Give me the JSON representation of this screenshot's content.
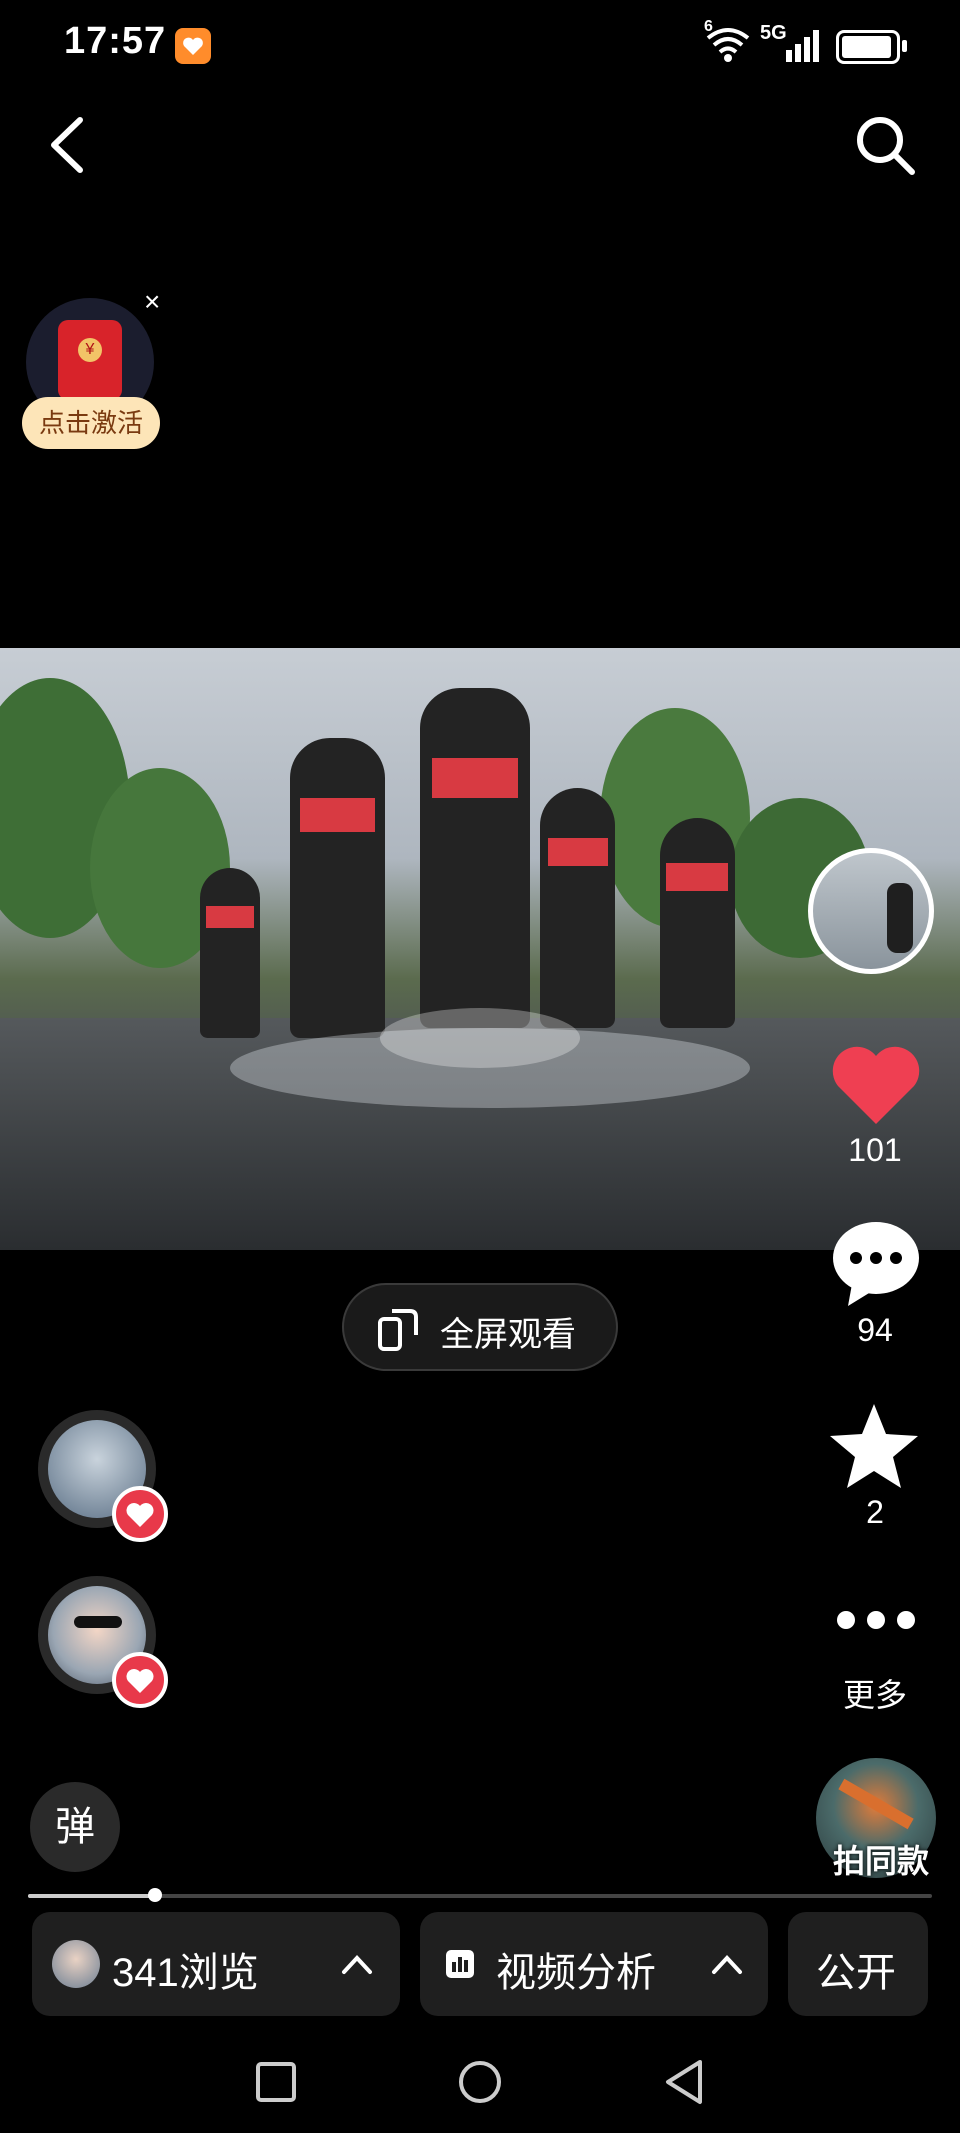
{
  "status_bar": {
    "time": "17:57",
    "network_label": "5G",
    "wifi_superscript": "6",
    "icons": [
      "notification-app-icon",
      "wifi-icon",
      "signal-icon",
      "battery-icon"
    ]
  },
  "header": {
    "back_icon": "chevron-left-icon",
    "search_icon": "search-icon"
  },
  "promo": {
    "activate_label": "点击激活",
    "coin_symbol": "¥",
    "close_symbol": "×"
  },
  "fullscreen_button": {
    "label": "全屏观看"
  },
  "side_actions": {
    "like_count": "101",
    "comment_count": "94",
    "favorite_count": "2",
    "more_label": "更多",
    "same_style_label": "拍同款"
  },
  "danmu": {
    "label": "弹"
  },
  "progress": {
    "played_fraction": 0.14
  },
  "bottom_bar": {
    "views_label": "341浏览",
    "analysis_label": "视频分析",
    "visibility_label": "公开"
  },
  "colors": {
    "like_red": "#ef3f52",
    "badge_red": "#e8394a",
    "activate_bg": "#fde5b8"
  }
}
